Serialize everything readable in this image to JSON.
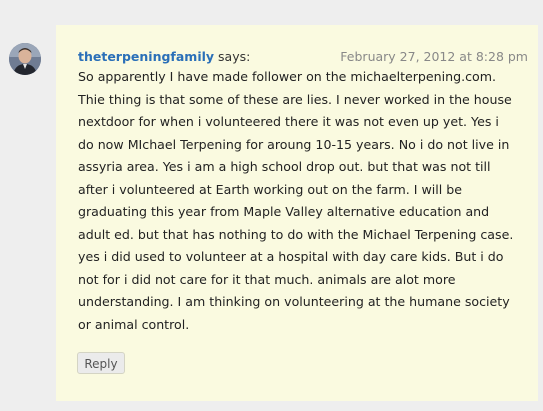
{
  "comment": {
    "author": "theterpeningfamily",
    "says": "says:",
    "date": "February 27, 2012 at 8:28 pm",
    "body": "So apparently I have made follower on the michaelterpening.com. Thie thing is that some of these are lies. I never worked in the house nextdoor for when i volunteered there it was not even up yet. Yes i do now MIchael Terpening for aroung 10-15 years. No i do not live in assyria area. Yes i am a high school drop out. but that was not till after i volunteered at Earth working out on the farm. I will be graduating this year from Maple Valley alternative education and adult ed. but that has nothing to do with the Michael Terpening case. yes i did used to volunteer at a hospital with day care kids. But i do not for i did not care for it that much. animals are alot more understanding. I am thinking on volunteering at the humane society or animal control.",
    "reply_label": "Reply",
    "avatar_icon": "user-avatar"
  },
  "colors": {
    "page_background": "#eeeeee",
    "comment_background": "#fafae0",
    "author_link": "#2a6fb8",
    "date_text": "#888888"
  }
}
